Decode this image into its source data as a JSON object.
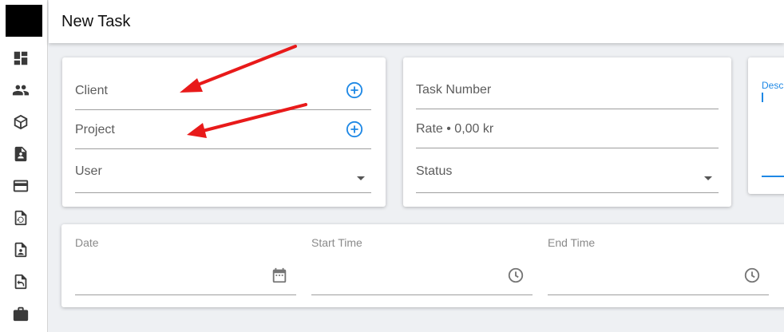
{
  "header": {
    "title": "New Task"
  },
  "sidebar": {
    "items": [
      {
        "icon": "dashboard-icon"
      },
      {
        "icon": "people-icon"
      },
      {
        "icon": "box-icon"
      },
      {
        "icon": "contact-document-icon"
      },
      {
        "icon": "credit-card-icon"
      },
      {
        "icon": "history-document-icon"
      },
      {
        "icon": "person-document-icon"
      },
      {
        "icon": "undo-document-icon"
      },
      {
        "icon": "briefcase-icon"
      }
    ]
  },
  "card_left": {
    "client_label": "Client",
    "project_label": "Project",
    "user_label": "User"
  },
  "card_middle": {
    "task_number_label": "Task Number",
    "rate_label": "Rate • 0,00 kr",
    "status_label": "Status"
  },
  "card_right": {
    "description_label": "Desc"
  },
  "time_card": {
    "date_label": "Date",
    "start_time_label": "Start Time",
    "end_time_label": "End Time"
  },
  "colors": {
    "accent": "#1e88e5",
    "annotation_arrow": "#e81a1a"
  }
}
